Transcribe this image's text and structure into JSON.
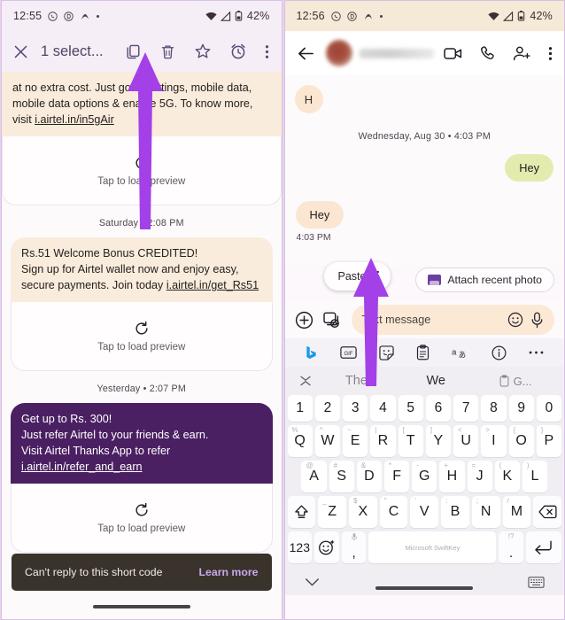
{
  "left": {
    "status": {
      "time": "12:55",
      "battery": "42%",
      "icons": [
        "whatsapp-icon",
        "circle-d-icon",
        "airtel-icon",
        "dot-icon"
      ],
      "right_icons": [
        "wifi-icon",
        "signal-icon",
        "battery-icon"
      ]
    },
    "toolbar": {
      "close_label": "✕",
      "title": "1 select...",
      "actions": [
        "copy-icon",
        "delete-icon",
        "star-icon",
        "alarm-icon",
        "overflow-icon"
      ]
    },
    "messages": [
      {
        "type": "sms",
        "text": "at no extra cost. Just go to settings, mobile data, mobile data options & enable 5G. To know more, visit ",
        "link": "i.airtel.in/in5gAir",
        "preview_label": "Tap to load preview",
        "preview_icon": "refresh-icon"
      },
      {
        "type": "daystamp",
        "text": "Saturday • 2:08 PM"
      },
      {
        "type": "sms",
        "text": "Rs.51 Welcome Bonus CREDITED!\nSign up for Airtel wallet now and enjoy easy, secure payments. Join today ",
        "link": "i.airtel.in/get_Rs51",
        "preview_label": "Tap to load preview",
        "preview_icon": "refresh-icon"
      },
      {
        "type": "daystamp",
        "text": "Yesterday • 2:07 PM"
      },
      {
        "type": "sms-selected",
        "text": "Get up to Rs. 300!\nJust refer Airtel to your friends & earn.\nVisit Airtel Thanks App to refer ",
        "link": "i.airtel.in/refer_and_earn",
        "preview_label": "Tap to load preview",
        "preview_icon": "refresh-icon",
        "time": "2:07 PM"
      }
    ],
    "snackbar": {
      "text": "Can't reply to this short code",
      "action": "Learn more"
    }
  },
  "right": {
    "status": {
      "time": "12:56",
      "battery": "42%"
    },
    "header": {
      "back_icon": "back-arrow-icon",
      "contact_name": "",
      "actions": [
        "video-call-icon",
        "phone-call-icon",
        "add-person-icon",
        "overflow-icon"
      ]
    },
    "chat": {
      "avatar_initial": "H",
      "daystamp": "Wednesday, Aug 30 • 4:03 PM",
      "messages": [
        {
          "dir": "out",
          "text": "Hey"
        },
        {
          "dir": "in",
          "text": "Hey",
          "time": "4:03 PM"
        }
      ]
    },
    "chip": {
      "label": "Attach recent photo",
      "icon": "image-icon"
    },
    "paste_popup": {
      "label": "Paste",
      "menu_icon": "kebab-icon"
    },
    "composer": {
      "plus_icon": "plus-icon",
      "gallery_icon": "gallery-icon",
      "placeholder": "Text message",
      "emoji_icon": "emoji-icon",
      "mic_icon": "mic-icon"
    },
    "keyboard": {
      "toolbar_icons": [
        "bing-icon",
        "gif-icon",
        "sticker-icon",
        "clipboard-icon",
        "translate-icon",
        "info-icon",
        "more-icon"
      ],
      "suggestions": {
        "collapse_icon": "collapse-icon",
        "items": [
          "The",
          "We",
          "G..."
        ],
        "clip_icon": "clipboard-icon"
      },
      "number_row": [
        "1",
        "2",
        "3",
        "4",
        "5",
        "6",
        "7",
        "8",
        "9",
        "0"
      ],
      "row1": [
        {
          "k": "Q",
          "a": "%"
        },
        {
          "k": "W",
          "a": "^"
        },
        {
          "k": "E",
          "a": "~"
        },
        {
          "k": "R",
          "a": "|"
        },
        {
          "k": "T",
          "a": "["
        },
        {
          "k": "Y",
          "a": "]"
        },
        {
          "k": "U",
          "a": "<"
        },
        {
          "k": "I",
          "a": ">"
        },
        {
          "k": "O",
          "a": "{"
        },
        {
          "k": "P",
          "a": "}"
        }
      ],
      "row2": [
        {
          "k": "A",
          "a": "@"
        },
        {
          "k": "S",
          "a": "#"
        },
        {
          "k": "D",
          "a": "&"
        },
        {
          "k": "F",
          "a": "*"
        },
        {
          "k": "G",
          "a": "-"
        },
        {
          "k": "H",
          "a": "+"
        },
        {
          "k": "J",
          "a": "="
        },
        {
          "k": "K",
          "a": "("
        },
        {
          "k": "L",
          "a": ")"
        }
      ],
      "row3": [
        {
          "k": "Z",
          "a": "_"
        },
        {
          "k": "X",
          "a": "$"
        },
        {
          "k": "C",
          "a": "\""
        },
        {
          "k": "V",
          "a": "'"
        },
        {
          "k": "B",
          "a": ":"
        },
        {
          "k": "N",
          "a": ";"
        },
        {
          "k": "M",
          "a": "/"
        }
      ],
      "shift_icon": "shift-icon",
      "backspace_icon": "backspace-icon",
      "numeric_key": "123",
      "emoji_key_icon": "emoji-sparkle-icon",
      "comma_key": ",",
      "comma_alt_icon": "mic-icon",
      "space_label": "Microsoft SwiftKey",
      "period_key": ".",
      "period_alt": "!?",
      "enter_icon": "enter-icon",
      "nav": {
        "down_icon": "chevron-down-icon",
        "keyboard_icon": "keyboard-icon"
      }
    }
  },
  "annotations": {
    "arrows": [
      {
        "name": "arrow-to-copy-icon",
        "color": "#a340e8"
      },
      {
        "name": "arrow-to-paste-popup",
        "color": "#a340e8"
      }
    ],
    "arrow_color": "#a340e8"
  }
}
